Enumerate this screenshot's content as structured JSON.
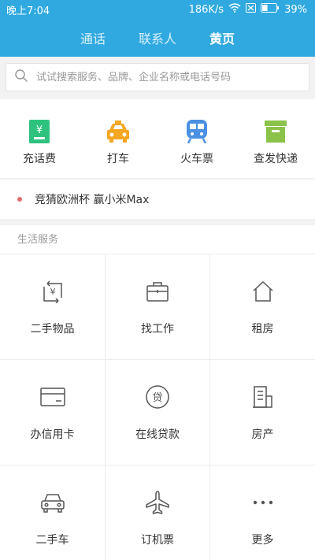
{
  "status_bar": {
    "time": "晚上7:04",
    "network_speed": "186K/s",
    "battery": "39%"
  },
  "tabs": [
    {
      "label": "通话",
      "active": false
    },
    {
      "label": "联系人",
      "active": false
    },
    {
      "label": "黄页",
      "active": true
    }
  ],
  "search": {
    "placeholder": "试试搜索服务、品牌、企业名称或电话号码"
  },
  "quick_actions": [
    {
      "label": "充话费",
      "icon": "phone-bill-icon",
      "color": "#2ec27e"
    },
    {
      "label": "打车",
      "icon": "taxi-icon",
      "color": "#f5a623"
    },
    {
      "label": "火车票",
      "icon": "train-icon",
      "color": "#4a90e2"
    },
    {
      "label": "查发快递",
      "icon": "package-icon",
      "color": "#8bc34a"
    }
  ],
  "promo": {
    "text": "竞猜欧洲杯 赢小米Max",
    "dot_color": "#e46b6b"
  },
  "services": {
    "title": "生活服务",
    "items": [
      {
        "label": "二手物品",
        "icon": "exchange-icon"
      },
      {
        "label": "找工作",
        "icon": "briefcase-icon"
      },
      {
        "label": "租房",
        "icon": "house-icon"
      },
      {
        "label": "办信用卡",
        "icon": "credit-card-icon"
      },
      {
        "label": "在线贷款",
        "icon": "loan-icon"
      },
      {
        "label": "房产",
        "icon": "building-icon"
      },
      {
        "label": "二手车",
        "icon": "car-icon"
      },
      {
        "label": "订机票",
        "icon": "airplane-icon"
      },
      {
        "label": "更多",
        "icon": "more-icon"
      }
    ]
  },
  "colors": {
    "header_bg": "#2fa9e0",
    "icon_stroke": "#555555"
  }
}
